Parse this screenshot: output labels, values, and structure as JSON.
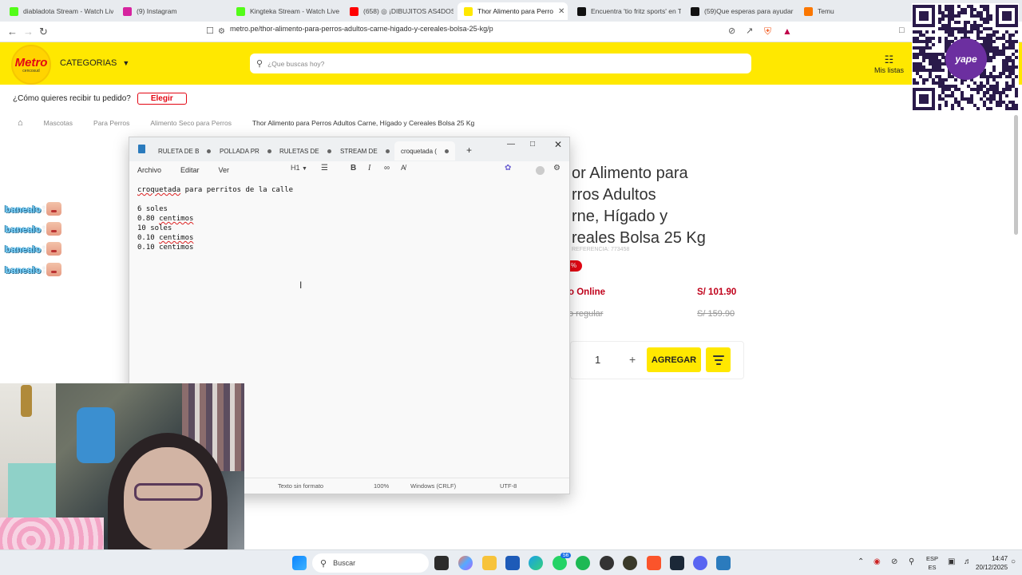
{
  "browser": {
    "tabs": [
      {
        "label": "diabladota Stream - Watch Liv",
        "icon": "kick-icon",
        "color": "#53fc18"
      },
      {
        "label": "(9) Instagram",
        "icon": "instagram-icon",
        "color": "#d6249f"
      },
      {
        "label": "Kingteka Stream - Watch Live o",
        "icon": "kick-icon",
        "color": "#53fc18"
      },
      {
        "label": "(658) ◎ ¡DIBUJITOS AS4DOS",
        "icon": "youtube-icon",
        "color": "#ff0000"
      },
      {
        "label": "Thor Alimento para Perro",
        "icon": "metro-icon",
        "color": "#ffe800"
      },
      {
        "label": "Encuentra 'tio fritz sports' en T",
        "icon": "tiktok-icon",
        "color": "#111111"
      },
      {
        "label": "(59)Que esperas para ayudar",
        "icon": "tiktok-icon",
        "color": "#111111"
      },
      {
        "label": "Temu",
        "icon": "temu-icon",
        "color": "#fb7701"
      }
    ],
    "url": "metro.pe/thor-alimento-para-perros-adultos-carne-higado-y-cereales-bolsa-25-kg/p"
  },
  "site": {
    "logo_word": "Metro",
    "logo_sub": "cencosud",
    "categories_label": "CATEGORIAS",
    "search_placeholder": "¿Que buscas hoy?",
    "mis_listas": "Mis listas",
    "delivery_question": "¿Cómo quieres recibir tu pedido?",
    "elegir_label": "Elegir",
    "breadcrumb": [
      "Mascotas",
      "Para Perros",
      "Alimento Seco para Perros",
      "Thor Alimento para Perros Adultos Carne, Hígado y Cereales Bolsa 25 Kg"
    ],
    "product": {
      "title_lines": [
        "or Alimento para",
        "rros Adultos",
        "rne, Hígado y",
        "reales Bolsa 25 Kg"
      ],
      "reference": "REFERENCIA: 773458",
      "discount": "%",
      "online_label": "o Online",
      "online_price": "S/ 101.90",
      "regular_label": "o regular",
      "regular_price": "S/ 159.90",
      "qty": "1",
      "plus": "+",
      "add_label": "AGREGAR"
    }
  },
  "chat": [
    {
      "name": "banealo",
      "sep": ":"
    },
    {
      "name": "banealo",
      "sep": ":"
    },
    {
      "name": "banealo",
      "sep": ":"
    },
    {
      "name": "banealo",
      "sep": ":"
    }
  ],
  "notepad": {
    "tabs": [
      "RULETA DE B",
      "POLLADA PR",
      "RULETAS DE",
      "STREAM DE",
      "croquetada ("
    ],
    "menu": [
      "Archivo",
      "Editar",
      "Ver"
    ],
    "heading_select": "H1",
    "lines": [
      {
        "parts": [
          {
            "text": "croquetada",
            "spell": true
          },
          {
            "text": " para perritos de la calle",
            "spell": false
          }
        ]
      },
      {
        "parts": [
          {
            "text": "",
            "spell": false
          }
        ]
      },
      {
        "parts": [
          {
            "text": "6 soles",
            "spell": false
          }
        ]
      },
      {
        "parts": [
          {
            "text": "0.80 ",
            "spell": false
          },
          {
            "text": "centimos",
            "spell": true
          }
        ]
      },
      {
        "parts": [
          {
            "text": "10 soles",
            "spell": false
          }
        ]
      },
      {
        "parts": [
          {
            "text": "0.10 ",
            "spell": false
          },
          {
            "text": "centimos",
            "spell": true
          }
        ]
      },
      {
        "parts": [
          {
            "text": "0.10 centimos",
            "spell": false
          }
        ]
      }
    ],
    "status": {
      "format": "Texto sin formato",
      "zoom": "100%",
      "eol": "Windows (CRLF)",
      "encoding": "UTF-8"
    }
  },
  "qr": {
    "brand": "yape"
  },
  "taskbar": {
    "search": "Buscar",
    "badge": "56",
    "lang_top": "ESP",
    "lang_bottom": "ES",
    "time": "14:47",
    "date": "20/12/2025"
  }
}
